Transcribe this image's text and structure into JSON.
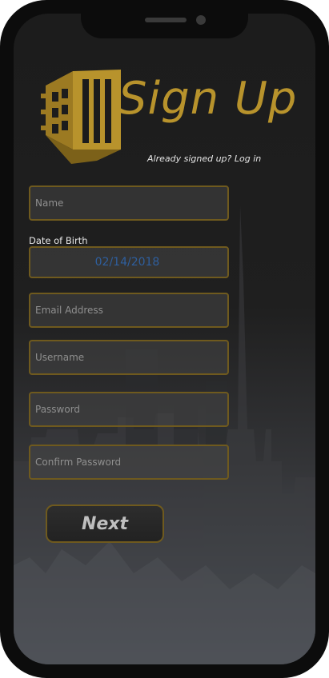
{
  "app": {
    "title": "Sign Up"
  },
  "header": {
    "login_prompt": "Already signed up? Log in"
  },
  "form": {
    "name_placeholder": "Name",
    "dob_label": "Date of Birth",
    "dob_value": "02/14/2018",
    "email_placeholder": "Email Address",
    "username_placeholder": "Username",
    "password_placeholder": "Password",
    "confirm_password_placeholder": "Confirm Password",
    "next_label": "Next"
  },
  "colors": {
    "brand_gold": "#b8932c",
    "field_border": "#6f5a1e",
    "date_text": "#2f5f9e"
  },
  "icons": {
    "logo": "building-logo-icon"
  }
}
